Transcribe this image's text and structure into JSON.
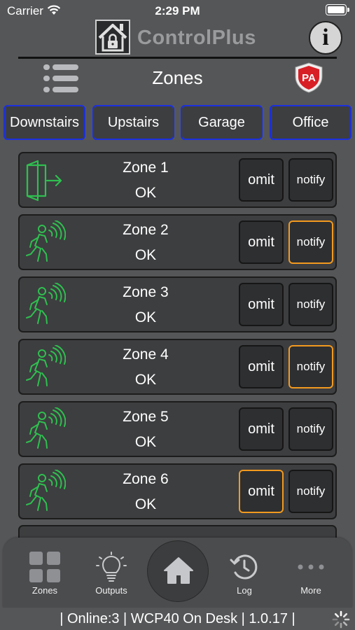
{
  "status_bar": {
    "carrier": "Carrier",
    "time": "2:29 PM"
  },
  "header": {
    "brand": "ControlPlus",
    "info_label": "i"
  },
  "page": {
    "title": "Zones",
    "badge": "PA"
  },
  "tabs": [
    "Downstairs",
    "Upstairs",
    "Garage",
    "Office"
  ],
  "zones": [
    {
      "name": "Zone 1",
      "status": "OK",
      "icon": "door-exit-icon",
      "omit": "omit",
      "notify": "notify",
      "omit_active": false,
      "notify_active": false
    },
    {
      "name": "Zone 2",
      "status": "OK",
      "icon": "motion-sensor-icon",
      "omit": "omit",
      "notify": "notify",
      "omit_active": false,
      "notify_active": true
    },
    {
      "name": "Zone 3",
      "status": "OK",
      "icon": "motion-sensor-icon",
      "omit": "omit",
      "notify": "notify",
      "omit_active": false,
      "notify_active": false
    },
    {
      "name": "Zone 4",
      "status": "OK",
      "icon": "motion-sensor-icon",
      "omit": "omit",
      "notify": "notify",
      "omit_active": false,
      "notify_active": true
    },
    {
      "name": "Zone 5",
      "status": "OK",
      "icon": "motion-sensor-icon",
      "omit": "omit",
      "notify": "notify",
      "omit_active": false,
      "notify_active": false
    },
    {
      "name": "Zone 6",
      "status": "OK",
      "icon": "motion-sensor-icon",
      "omit": "omit",
      "notify": "notify",
      "omit_active": true,
      "notify_active": false
    }
  ],
  "tabbar": {
    "zones": "Zones",
    "outputs": "Outputs",
    "log": "Log",
    "more": "More"
  },
  "footer": {
    "status": "| Online:3 | WCP40 On Desk | 1.0.17 |"
  },
  "colors": {
    "background": "#555658",
    "tab_border": "#1a30e0",
    "active_border": "#f29a1f",
    "sensor_green": "#2fbf4f",
    "badge_red": "#d81f26"
  }
}
